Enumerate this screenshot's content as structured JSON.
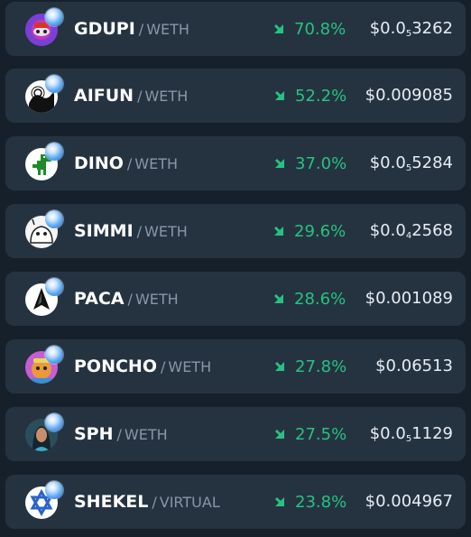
{
  "colors": {
    "background": "#15202a",
    "row_background": "#253341",
    "positive": "#27c281",
    "symbol_text": "#ffffff",
    "pair_text": "#8897a6",
    "price_text": "#e7edf3"
  },
  "tokens": [
    {
      "symbol": "GDUPI",
      "quote": "WETH",
      "change": "70.8%",
      "price_prefix": "$0.0",
      "price_zeros": "5",
      "price_digits": "3262",
      "avatar_icon": "gdupi-token-icon"
    },
    {
      "symbol": "AIFUN",
      "quote": "WETH",
      "change": "52.2%",
      "price_prefix": "$0.009085",
      "price_zeros": "",
      "price_digits": "",
      "avatar_icon": "aifun-token-icon"
    },
    {
      "symbol": "DINO",
      "quote": "WETH",
      "change": "37.0%",
      "price_prefix": "$0.0",
      "price_zeros": "5",
      "price_digits": "5284",
      "avatar_icon": "dino-token-icon"
    },
    {
      "symbol": "SIMMI",
      "quote": "WETH",
      "change": "29.6%",
      "price_prefix": "$0.0",
      "price_zeros": "4",
      "price_digits": "2568",
      "avatar_icon": "simmi-token-icon"
    },
    {
      "symbol": "PACA",
      "quote": "WETH",
      "change": "28.6%",
      "price_prefix": "$0.001089",
      "price_zeros": "",
      "price_digits": "",
      "avatar_icon": "paca-token-icon"
    },
    {
      "symbol": "PONCHO",
      "quote": "WETH",
      "change": "27.8%",
      "price_prefix": "$0.06513",
      "price_zeros": "",
      "price_digits": "",
      "avatar_icon": "poncho-token-icon"
    },
    {
      "symbol": "SPH",
      "quote": "WETH",
      "change": "27.5%",
      "price_prefix": "$0.0",
      "price_zeros": "5",
      "price_digits": "1129",
      "avatar_icon": "sph-token-icon"
    },
    {
      "symbol": "SHEKEL",
      "quote": "VIRTUAL",
      "change": "23.8%",
      "price_prefix": "$0.004967",
      "price_zeros": "",
      "price_digits": "",
      "avatar_icon": "shekel-token-icon"
    }
  ]
}
